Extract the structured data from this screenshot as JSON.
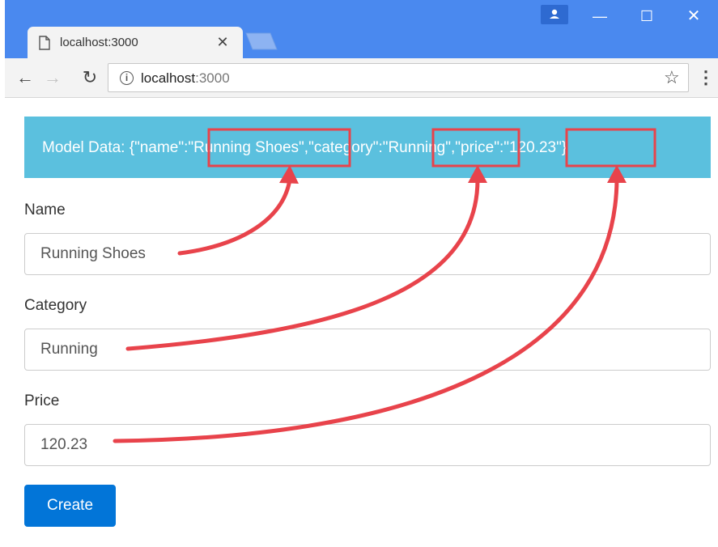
{
  "browser": {
    "tab_title": "localhost:3000",
    "url_host": "localhost",
    "url_port": ":3000"
  },
  "icons": {
    "tab": "page-icon",
    "close": "close-icon",
    "back": "back-arrow-icon",
    "forward": "forward-arrow-icon",
    "reload": "reload-icon",
    "info": "info-icon",
    "bookmark": "star-icon",
    "menu": "kebab-menu-icon",
    "profile": "person-icon"
  },
  "model": {
    "prefix": "Model Data: {\"name\":",
    "name_value": "\"Running Shoes\"",
    "mid1": ",\"category\":",
    "category_value": "\"Running\"",
    "mid2": ",\"price\"",
    "price_value": ":\"120.23\"}"
  },
  "form": {
    "name_label": "Name",
    "name_value": "Running Shoes",
    "category_label": "Category",
    "category_value": "Running",
    "price_label": "Price",
    "price_value": "120.23",
    "submit_label": "Create"
  },
  "colors": {
    "titlebar": "#4a89ef",
    "banner": "#5bc0de",
    "button": "#0275d8",
    "annotation": "#e8434b"
  }
}
